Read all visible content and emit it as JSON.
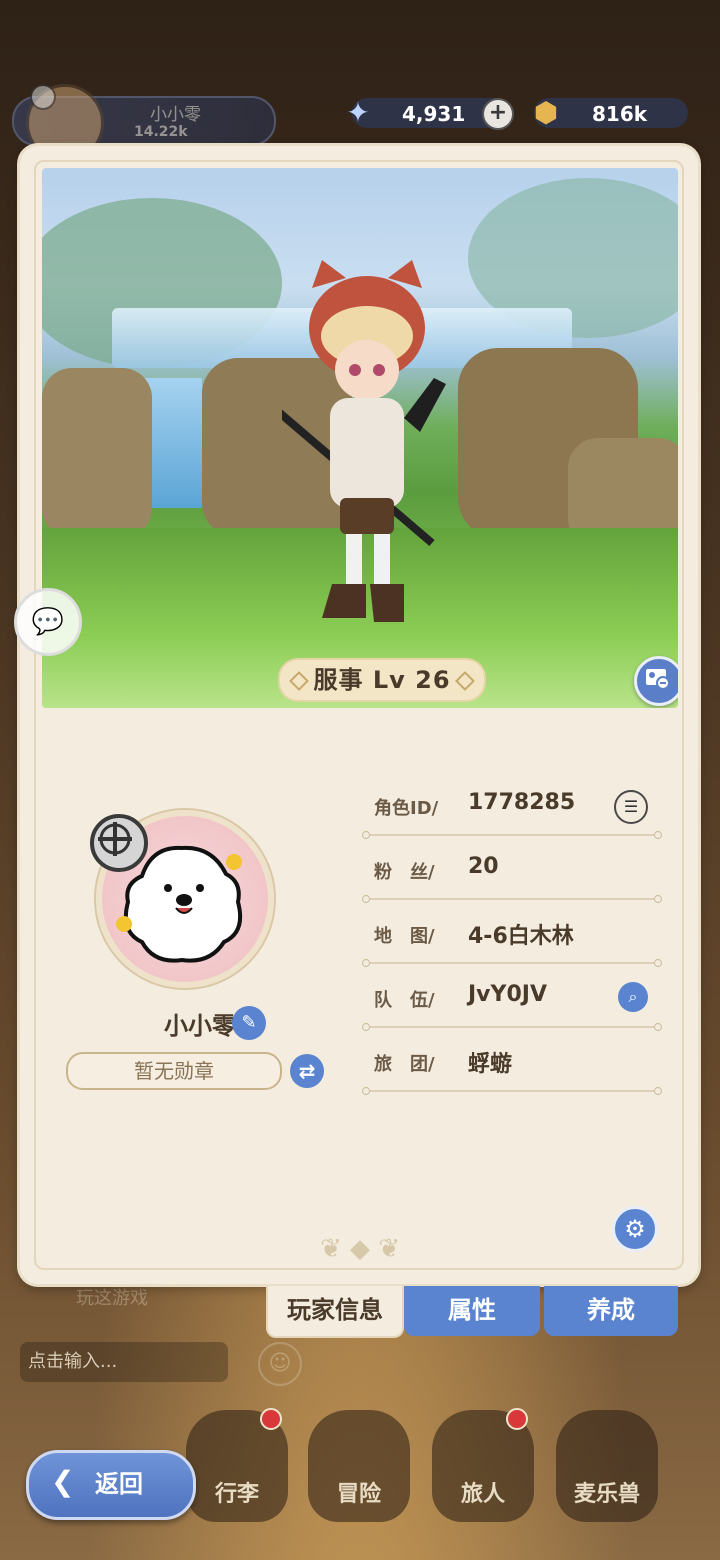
{
  "header": {
    "player_name": "小小零",
    "power": "14.22k",
    "currencies": [
      {
        "icon": "star-crystal-icon",
        "value": "4,931"
      },
      {
        "icon": "gold-coin-icon",
        "value": "816k"
      }
    ]
  },
  "card": {
    "level_banner": "服事 Lv 26",
    "name": "小小零",
    "medal_placeholder": "暂无勋章",
    "info_rows": [
      {
        "label": "角色ID/",
        "value": "1778285"
      },
      {
        "label": "粉　丝/",
        "value": "20"
      },
      {
        "label": "地　图/",
        "value": "4-6白木林"
      },
      {
        "label": "队　伍/",
        "value": "JvY0JV"
      },
      {
        "label": "旅　团/",
        "value": "蜉蝣"
      }
    ]
  },
  "tabs": [
    {
      "label": "玩家信息",
      "active": true
    },
    {
      "label": "属性",
      "active": false
    },
    {
      "label": "养成",
      "active": false
    }
  ],
  "background": {
    "play_text": "玩这游戏",
    "input_placeholder": "点击输入...",
    "nav": [
      "行李",
      "冒险",
      "旅人",
      "麦乐兽"
    ]
  },
  "back_button": "返回",
  "colors": {
    "accent_blue": "#5b84d0",
    "card_bg": "#f3ecdf",
    "text_brown": "#4a3a2a"
  }
}
